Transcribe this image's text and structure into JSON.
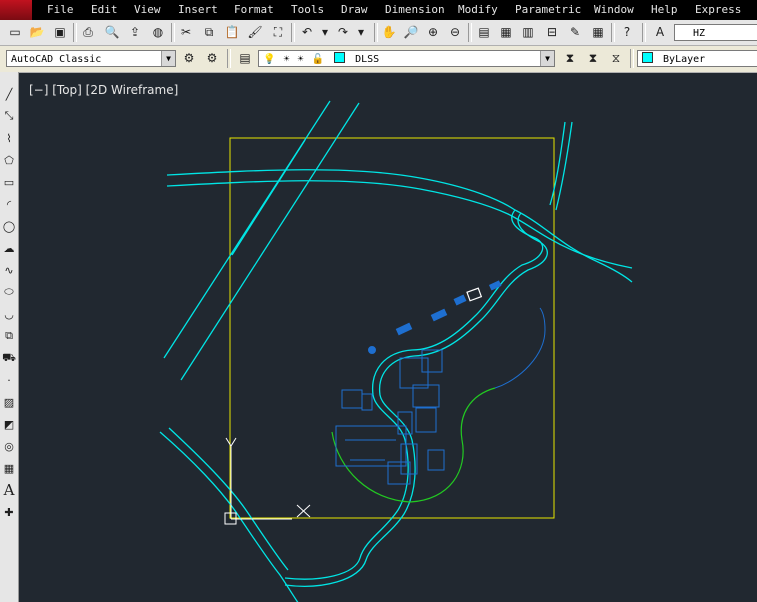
{
  "menubar": {
    "items": [
      "File",
      "Edit",
      "View",
      "Insert",
      "Format",
      "Tools",
      "Draw",
      "Dimension",
      "Modify",
      "Parametric",
      "Window",
      "Help",
      "Express"
    ]
  },
  "toolbar": {
    "text_style": "HZ",
    "workspace": "AutoCAD Classic",
    "layer": "DLSS",
    "color": "ByLayer"
  },
  "viewport": {
    "label": "[−] [Top] [2D Wireframe]"
  },
  "icons": {
    "top": [
      "new-icon",
      "open-icon",
      "save-icon",
      "print-icon",
      "print-preview-icon",
      "publish-icon",
      "cut-icon",
      "copy-icon",
      "paste-icon",
      "match-properties-icon",
      "undo-icon",
      "redo-icon",
      "pan-icon",
      "zoom-realtime-icon",
      "zoom-window-icon",
      "zoom-previous-icon",
      "properties-icon",
      "design-center-icon",
      "tool-palettes-icon",
      "sheet-set-icon",
      "markup-icon",
      "calculator-icon",
      "help-icon",
      "text-style-icon"
    ],
    "left": [
      "line-icon",
      "construction-line-icon",
      "polyline-icon",
      "polygon-icon",
      "rectangle-icon",
      "arc-icon",
      "circle-icon",
      "revision-cloud-icon",
      "spline-icon",
      "ellipse-icon",
      "ellipse-arc-icon",
      "insert-block-icon",
      "make-block-icon",
      "point-icon",
      "hatch-icon",
      "gradient-icon",
      "region-icon",
      "table-icon",
      "mtext-icon",
      "add-selected-icon"
    ]
  },
  "colors": {
    "background": "#212830",
    "roads": "#00e5e5",
    "buildings": "#1e6fd0",
    "boundary": "#e6e600",
    "green_line": "#22c922",
    "ucs": "#ffffff"
  }
}
